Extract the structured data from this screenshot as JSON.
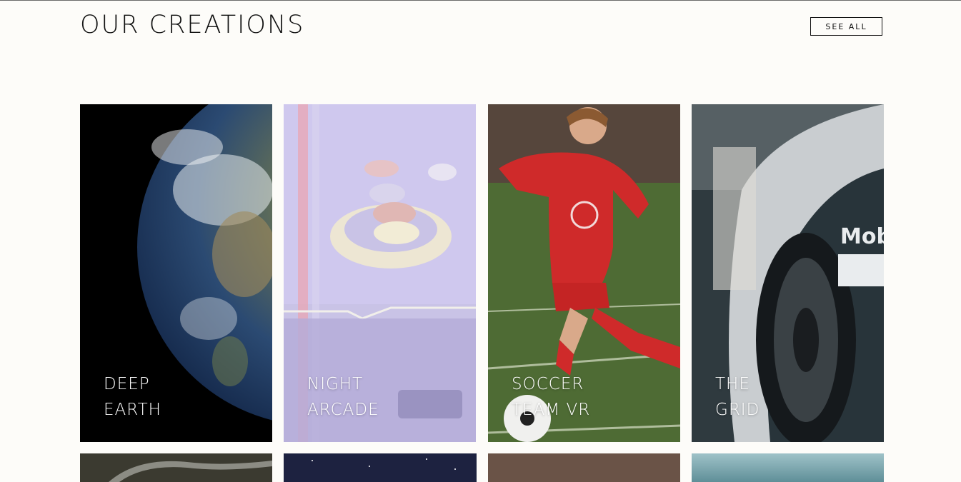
{
  "section": {
    "title": "OUR CREATIONS",
    "see_all_label": "SEE ALL"
  },
  "cards": [
    {
      "line1": "DEEP",
      "line2": "EARTH"
    },
    {
      "line1": "NIGHT",
      "line2": "ARCADE"
    },
    {
      "line1": "SOCCER",
      "line2": "TEAM VR"
    },
    {
      "line1": "THE",
      "line2": "GRID"
    }
  ],
  "colors": {
    "background": "#fdfcf9",
    "text": "#111111",
    "card_label": "#ffffff"
  }
}
